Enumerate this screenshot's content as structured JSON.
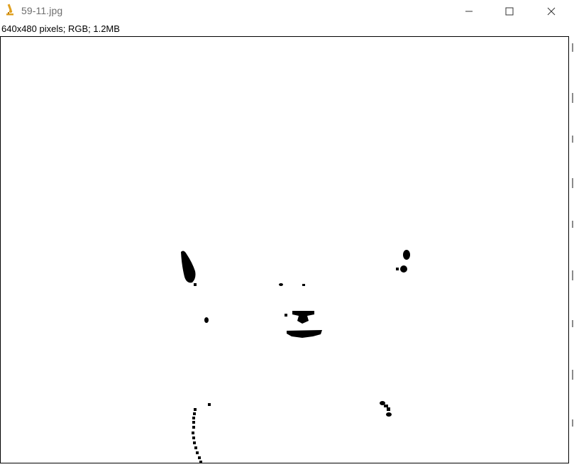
{
  "window": {
    "title": "59-11.jpg",
    "icon": "microscope-icon",
    "controls": [
      "minimize-icon",
      "maximize-icon",
      "close-icon"
    ]
  },
  "image_info": "640x480 pixels; RGB; 1.2MB",
  "colors": {
    "title_text": "#6e6e6e",
    "icon_accent": "#e0a020",
    "canvas_background": "#ffffff",
    "blob_color": "#000000"
  }
}
